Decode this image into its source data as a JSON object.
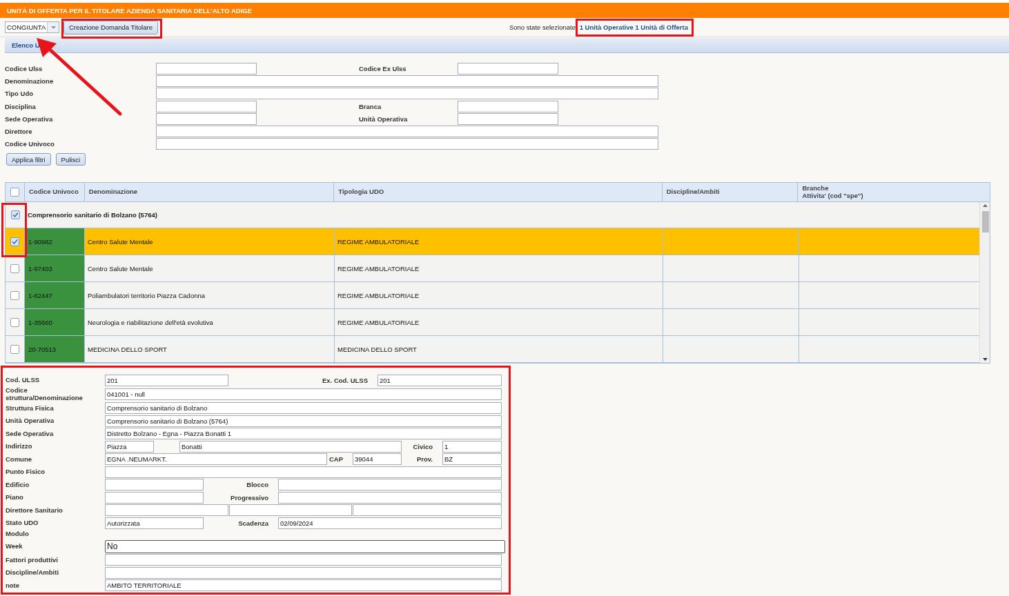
{
  "header": {
    "title": "UNITÀ DI OFFERTA PER IL TITOLARE AZIENDA SANITARIA DELL’ALTO ADIGE"
  },
  "toolbar": {
    "mode_select": {
      "value": "CONGIUNTA"
    },
    "create_button": "Creazione Domanda Titolare",
    "selection_text": "Sono state selezionate:",
    "selection_link": "1 Unità Operative 1 Unità di Offerta"
  },
  "section": {
    "title": "Elenco U"
  },
  "filters": [
    {
      "kind": "pair",
      "label": "Codice Ulss",
      "label2": "Codice Ex Ulss"
    },
    {
      "kind": "full",
      "label": "Denominazione"
    },
    {
      "kind": "full",
      "label": "Tipo Udo"
    },
    {
      "kind": "pair",
      "label": "Disciplina",
      "label2": "Branca"
    },
    {
      "kind": "pair",
      "label": "Sede Operativa",
      "label2": "Unità Operativa"
    },
    {
      "kind": "full",
      "label": "Direttore"
    },
    {
      "kind": "full",
      "label": "Codice Univoco"
    }
  ],
  "filter_buttons": [
    "Applica filtri",
    "Pulisci"
  ],
  "table": {
    "select_all": {
      "checked": false
    },
    "columns": [
      "Codice Univoco",
      "Denominazione",
      "Tipologia UDO",
      "Discipline/Ambiti",
      "Branche\nAttivita' (cod \"spe\")"
    ],
    "group": {
      "label": "Comprensorio sanitario di Bolzano (5764)",
      "checked": true
    },
    "rows": [
      {
        "code": "1-90982",
        "name": "Centro Salute Mentale",
        "type": "REGIME AMBULATORIALE",
        "checked": true,
        "selected": true
      },
      {
        "code": "1-97403",
        "name": "Centro Salute Mentale",
        "type": "REGIME AMBULATORIALE",
        "checked": false,
        "selected": false
      },
      {
        "code": "1-62447",
        "name": "Poliambulatori territorio Piazza Cadonna",
        "type": "REGIME AMBULATORIALE",
        "checked": false,
        "selected": false
      },
      {
        "code": "1-35660",
        "name": "Neurologia e riabilitazione dell'età evolutiva",
        "type": "REGIME AMBULATORIALE",
        "checked": false,
        "selected": false
      },
      {
        "code": "20-70513",
        "name": "MEDICINA DELLO SPORT",
        "type": "MEDICINA DELLO SPORT",
        "checked": false,
        "selected": false
      }
    ]
  },
  "detail": {
    "rows": [
      {
        "kind": "pair_wide",
        "label": "Cod. ULSS",
        "value": "201",
        "label2": "Ex. Cod. ULSS",
        "value2": "201"
      },
      {
        "kind": "full",
        "label": "Codice struttura/Denominazione",
        "value": "041001 - null"
      },
      {
        "kind": "full",
        "label": "Struttura Fisica",
        "value": "Comprensorio sanitario di Bolzano"
      },
      {
        "kind": "full",
        "label": "Unità Operativa",
        "value": "Comprensorio sanitario di Bolzano (5764)"
      },
      {
        "kind": "full",
        "label": "Sede Operativa",
        "value": "Distretto Bolzano - Egna - Piazza Bonatti 1"
      },
      {
        "kind": "address",
        "label": "Indirizzo",
        "value": "Piazza",
        "value2": "Bonatti",
        "label3": "Civico",
        "value3": "1"
      },
      {
        "kind": "comune",
        "label": "Comune",
        "value": "EGNA .NEUMARKT.",
        "label2": "CAP",
        "value2": "39044",
        "label3": "Prov.",
        "value3": "BZ"
      },
      {
        "kind": "full",
        "label": "Punto Fisico"
      },
      {
        "kind": "pair",
        "label": "Edificio",
        "label2": "Blocco"
      },
      {
        "kind": "pair",
        "label": "Piano",
        "label2": "Progressivo"
      },
      {
        "kind": "triple",
        "label": "Direttore Sanitario"
      },
      {
        "kind": "pair",
        "label": "Stato UDO",
        "value": "Autorizzata",
        "label2": "Scadenza",
        "value2": "02/09/2024"
      },
      {
        "kind": "label",
        "label": "Modulo"
      },
      {
        "kind": "select",
        "label": "Week",
        "value": "No"
      },
      {
        "kind": "full",
        "label": "Fattori produttivi"
      },
      {
        "kind": "full",
        "label": "Discipline/Ambiti"
      },
      {
        "kind": "full",
        "label": "note",
        "value": "AMBITO TERRITORIALE"
      }
    ]
  }
}
